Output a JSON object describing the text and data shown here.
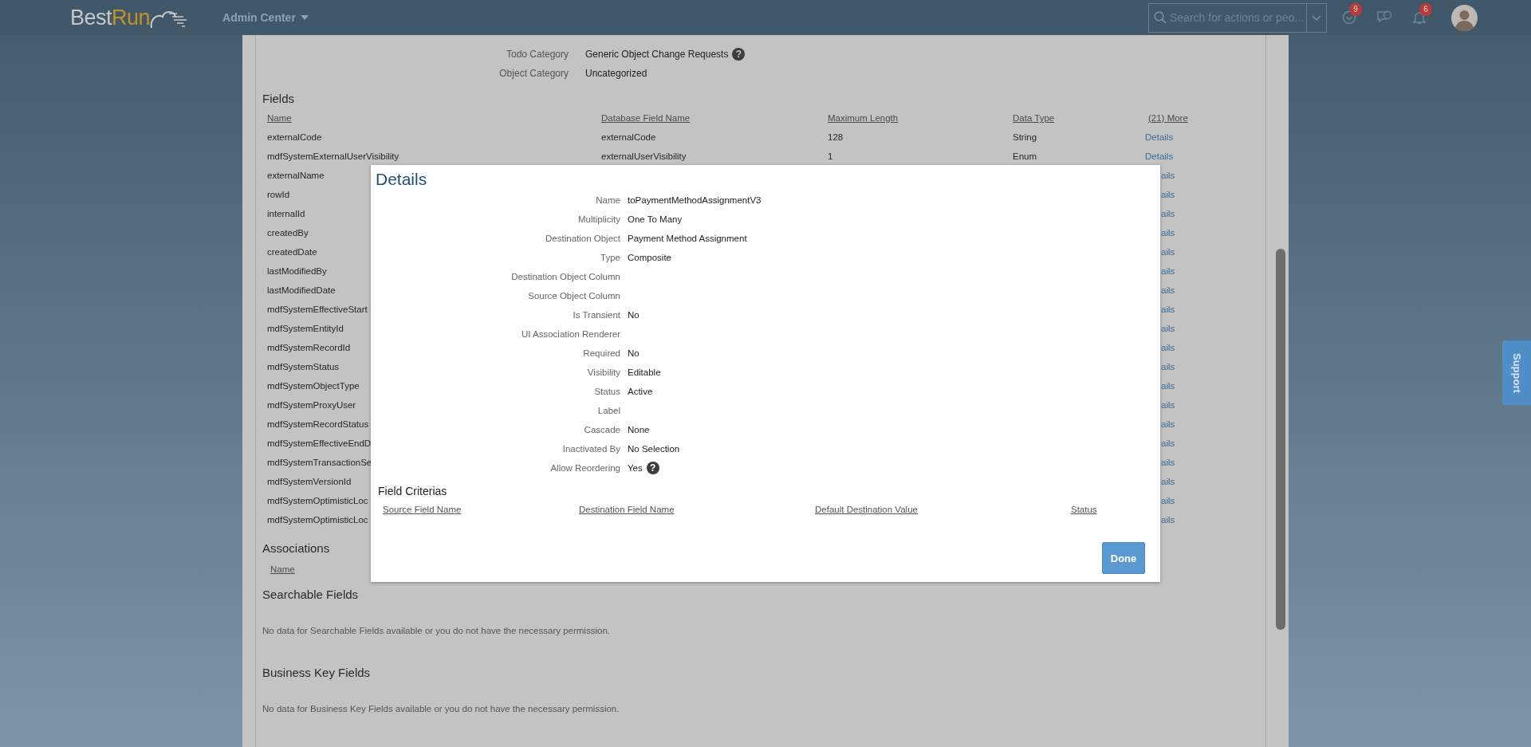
{
  "header": {
    "logo": {
      "part_1": "Best",
      "part_2": "Run"
    },
    "app_menu": "Admin Center",
    "search": {
      "placeholder": "Search for actions or peo..."
    },
    "todo_badge": "9",
    "notifications_badge": "6"
  },
  "object_info": [
    {
      "label": "Todo Category",
      "value": "Generic Object Change Requests",
      "help_icon": "?"
    },
    {
      "label": "Object Category",
      "value": "Uncategorized"
    }
  ],
  "fields": {
    "title": "Fields",
    "columns": [
      "Name",
      "Database Field Name",
      "Maximum Length",
      "Data Type",
      "(21) More"
    ],
    "rows": [
      {
        "name": "externalCode",
        "database_field_name": "externalCode",
        "maximum_length": "128",
        "data_type": "String",
        "link": "Details"
      },
      {
        "name": "mdfSystemExternalUserVisibility",
        "database_field_name": "externalUserVisibility",
        "maximum_length": "1",
        "data_type": "Enum",
        "link": "Details"
      },
      {
        "name": "externalName",
        "link": "ails"
      },
      {
        "name": "rowId",
        "link": "ails"
      },
      {
        "name": "internalId",
        "link": "ails"
      },
      {
        "name": "createdBy",
        "link": "ails"
      },
      {
        "name": "createdDate",
        "link": "ails"
      },
      {
        "name": "lastModifiedBy",
        "link": "ails"
      },
      {
        "name": "lastModifiedDate",
        "link": "ails"
      },
      {
        "name": "mdfSystemEffectiveStart",
        "link": "ails"
      },
      {
        "name": "mdfSystemEntityId",
        "link": "ails"
      },
      {
        "name": "mdfSystemRecordId",
        "link": "ails"
      },
      {
        "name": "mdfSystemStatus",
        "link": "ails"
      },
      {
        "name": "mdfSystemObjectType",
        "link": "ails"
      },
      {
        "name": "mdfSystemProxyUser",
        "link": "ails"
      },
      {
        "name": "mdfSystemRecordStatus",
        "link": "ails"
      },
      {
        "name": "mdfSystemEffectiveEndD",
        "link": "ails"
      },
      {
        "name": "mdfSystemTransactionSe",
        "link": "ails"
      },
      {
        "name": "mdfSystemVersionId",
        "link": "ails"
      },
      {
        "name": "mdfSystemOptimisticLoc",
        "link": "ails"
      },
      {
        "name": "mdfSystemOptimisticLoc",
        "link": "ails"
      }
    ]
  },
  "associations": {
    "title": "Associations",
    "columns": [
      "Name"
    ]
  },
  "searchable_fields": {
    "title": "Searchable Fields",
    "message": "No data for Searchable Fields available or you do not have the necessary permission."
  },
  "business_key_fields": {
    "title": "Business Key Fields",
    "message": "No data for Business Key Fields available or you do not have the necessary permission."
  },
  "dialog": {
    "title": "Details",
    "properties": [
      {
        "label": "Name",
        "value": "toPaymentMethodAssignmentV3"
      },
      {
        "label": "Multiplicity",
        "value": "One To Many"
      },
      {
        "label": "Destination Object",
        "value": "Payment Method Assignment"
      },
      {
        "label": "Type",
        "value": "Composite"
      },
      {
        "label": "Destination Object Column"
      },
      {
        "label": "Source Object Column"
      },
      {
        "label": "Is Transient",
        "value": "No"
      },
      {
        "label": "UI Association Renderer"
      },
      {
        "label": "Required",
        "value": "No"
      },
      {
        "label": "Visibility",
        "value": "Editable"
      },
      {
        "label": "Status",
        "value": "Active"
      },
      {
        "label": "Label"
      },
      {
        "label": "Cascade",
        "value": "None"
      },
      {
        "label": "Inactivated By",
        "value": "No Selection"
      },
      {
        "label": "Allow Reordering",
        "value": "Yes",
        "help_icon": "?"
      }
    ],
    "criteria": {
      "title": "Field Criterias",
      "columns": [
        "Source Field Name",
        "Destination Field Name",
        "Default Destination Value",
        "Status"
      ]
    },
    "done_button": "Done"
  },
  "support_tab": "Support"
}
